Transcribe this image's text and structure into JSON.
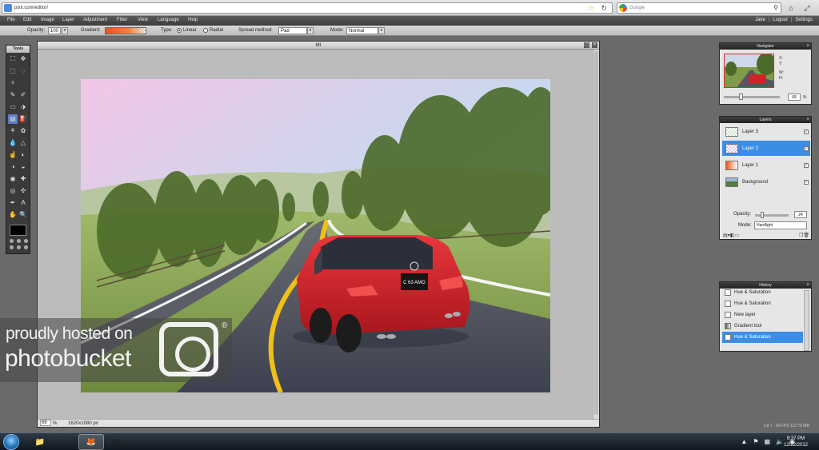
{
  "browser": {
    "url": "pixlr.com/editor/",
    "search_placeholder": "Google"
  },
  "menu": {
    "items": [
      "File",
      "Edit",
      "Image",
      "Layer",
      "Adjustment",
      "Filter",
      "View",
      "Language",
      "Help"
    ],
    "user": "Jake",
    "logout": "Logout",
    "settings": "Settings"
  },
  "options": {
    "opacity_label": "Opacity:",
    "opacity_value": "100",
    "gradient_label": "Gradient:",
    "type_label": "Type:",
    "type_linear": "Linear",
    "type_radial": "Radial",
    "spread_label": "Spread method:",
    "spread_value": "Pad",
    "mode_label": "Mode:",
    "mode_value": "Normal"
  },
  "tools": {
    "title": "Tools",
    "items": [
      "crop-icon",
      "move-icon",
      "marquee-icon",
      "lasso-icon",
      "wand-icon",
      "",
      "pencil-icon",
      "brush-icon",
      "eraser-icon",
      "replace-color-icon",
      "gradient-icon",
      "bucket-icon",
      "clone-icon",
      "color-replace-icon",
      "drop-icon",
      "sharpen-icon",
      "smudge-icon",
      "sponge-icon",
      "dodge-icon",
      "burn-icon",
      "redeye-icon",
      "spot-heal-icon",
      "bloat-icon",
      "pinch-icon",
      "picker-icon",
      "text-icon",
      "hand-icon",
      "zoom-icon"
    ],
    "glyphs": [
      "⛶",
      "✥",
      "⬚",
      "◌",
      "✧",
      "",
      "✎",
      "✐",
      "▭",
      "⬗",
      "▤",
      "⛽",
      "⚘",
      "✿",
      "💧",
      "△",
      "☝",
      "◐",
      "◑",
      "◒",
      "◉",
      "✚",
      "◎",
      "✣",
      "✒",
      "A",
      "✋",
      "🔍"
    ]
  },
  "canvas": {
    "title": "Mt",
    "zoom": "68",
    "zoom_unit": "%",
    "dimensions": "1620x1080 px",
    "plate_text": "C 63 AMG"
  },
  "navigator": {
    "title": "Navigator",
    "x_label": "X:",
    "y_label": "Y:",
    "w_label": "W:",
    "h_label": "H:",
    "zoom": "68",
    "unit": "%"
  },
  "layers": {
    "title": "Layers",
    "items": [
      {
        "name": "Layer 3",
        "selected": false
      },
      {
        "name": "Layer 2",
        "selected": true
      },
      {
        "name": "Layer 1",
        "selected": false
      },
      {
        "name": "Background",
        "selected": false
      }
    ],
    "opacity_label": "Opacity:",
    "opacity_value": "24",
    "mode_label": "Mode:",
    "mode_value": "Hardlight"
  },
  "history": {
    "title": "History",
    "items": [
      {
        "name": "Hue & Saturation",
        "selected": false
      },
      {
        "name": "Hue & Saturation",
        "selected": false
      },
      {
        "name": "New layer",
        "selected": false
      },
      {
        "name": "Gradient tool",
        "selected": false
      },
      {
        "name": "Hue & Saturation",
        "selected": true
      }
    ]
  },
  "version": "v.8.7 - 60 FPS 113.70 MB",
  "watermark": {
    "line1": "proudly hosted on",
    "line2": "photobucket",
    "reg": "®"
  },
  "taskbar": {
    "time": "9:37 PM",
    "date": "12/22/2012"
  },
  "colors": {
    "selection_blue": "#3a8ee6",
    "car_red": "#d0242a"
  }
}
